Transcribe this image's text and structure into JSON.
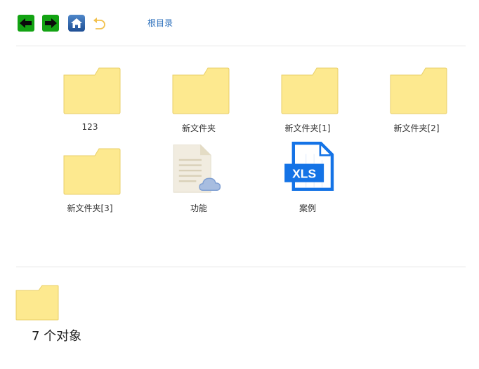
{
  "toolbar": {
    "back_icon": "arrow-left-icon",
    "forward_icon": "arrow-right-icon",
    "home_icon": "home-icon",
    "undo_icon": "undo-icon",
    "breadcrumb_label": "根目录"
  },
  "items": [
    {
      "label": "123",
      "icon": "folder-icon"
    },
    {
      "label": "新文件夹",
      "icon": "folder-icon"
    },
    {
      "label": "新文件夹[1]",
      "icon": "folder-icon"
    },
    {
      "label": "新文件夹[2]",
      "icon": "folder-icon"
    },
    {
      "label": "新文件夹[3]",
      "icon": "folder-icon"
    },
    {
      "label": "功能",
      "icon": "cloud-document-icon"
    },
    {
      "label": "案例",
      "icon": "xls-file-icon",
      "badge": "XLS"
    }
  ],
  "summary": {
    "icon": "folder-icon",
    "count_text": "7 个对象"
  },
  "colors": {
    "folder": "#fde98f",
    "folder_tab": "#fde38a",
    "nav_green": "#13a313",
    "link": "#2a6ebb",
    "xls_blue": "#1473e6"
  }
}
